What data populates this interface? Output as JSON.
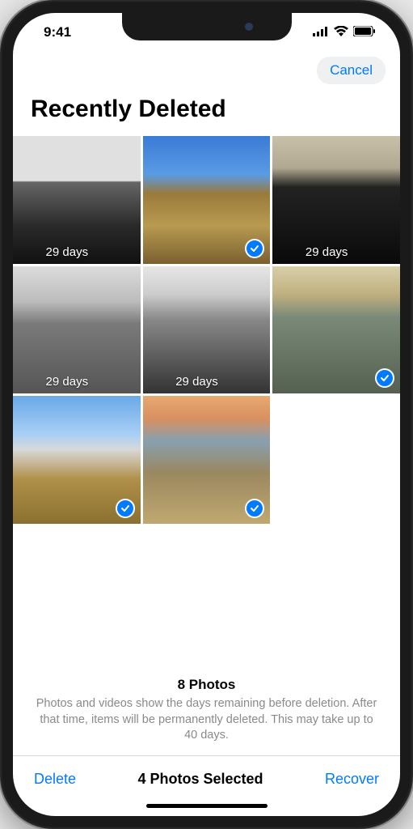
{
  "status": {
    "time": "9:41"
  },
  "nav": {
    "cancel": "Cancel"
  },
  "title": "Recently Deleted",
  "photos": [
    {
      "days": "29 days",
      "selected": false,
      "scene": "sc1"
    },
    {
      "days": "",
      "selected": true,
      "scene": "sc2"
    },
    {
      "days": "29 days",
      "selected": false,
      "scene": "sc3"
    },
    {
      "days": "29 days",
      "selected": false,
      "scene": "sc4"
    },
    {
      "days": "29 days",
      "selected": false,
      "scene": "sc5"
    },
    {
      "days": "",
      "selected": true,
      "scene": "sc6"
    },
    {
      "days": "",
      "selected": true,
      "scene": "sc7"
    },
    {
      "days": "",
      "selected": true,
      "scene": "sc8"
    }
  ],
  "summary": {
    "count": "8 Photos",
    "desc": "Photos and videos show the days remaining before deletion. After that time, items will be permanently deleted. This may take up to 40 days."
  },
  "toolbar": {
    "delete": "Delete",
    "selected": "4 Photos Selected",
    "recover": "Recover"
  }
}
